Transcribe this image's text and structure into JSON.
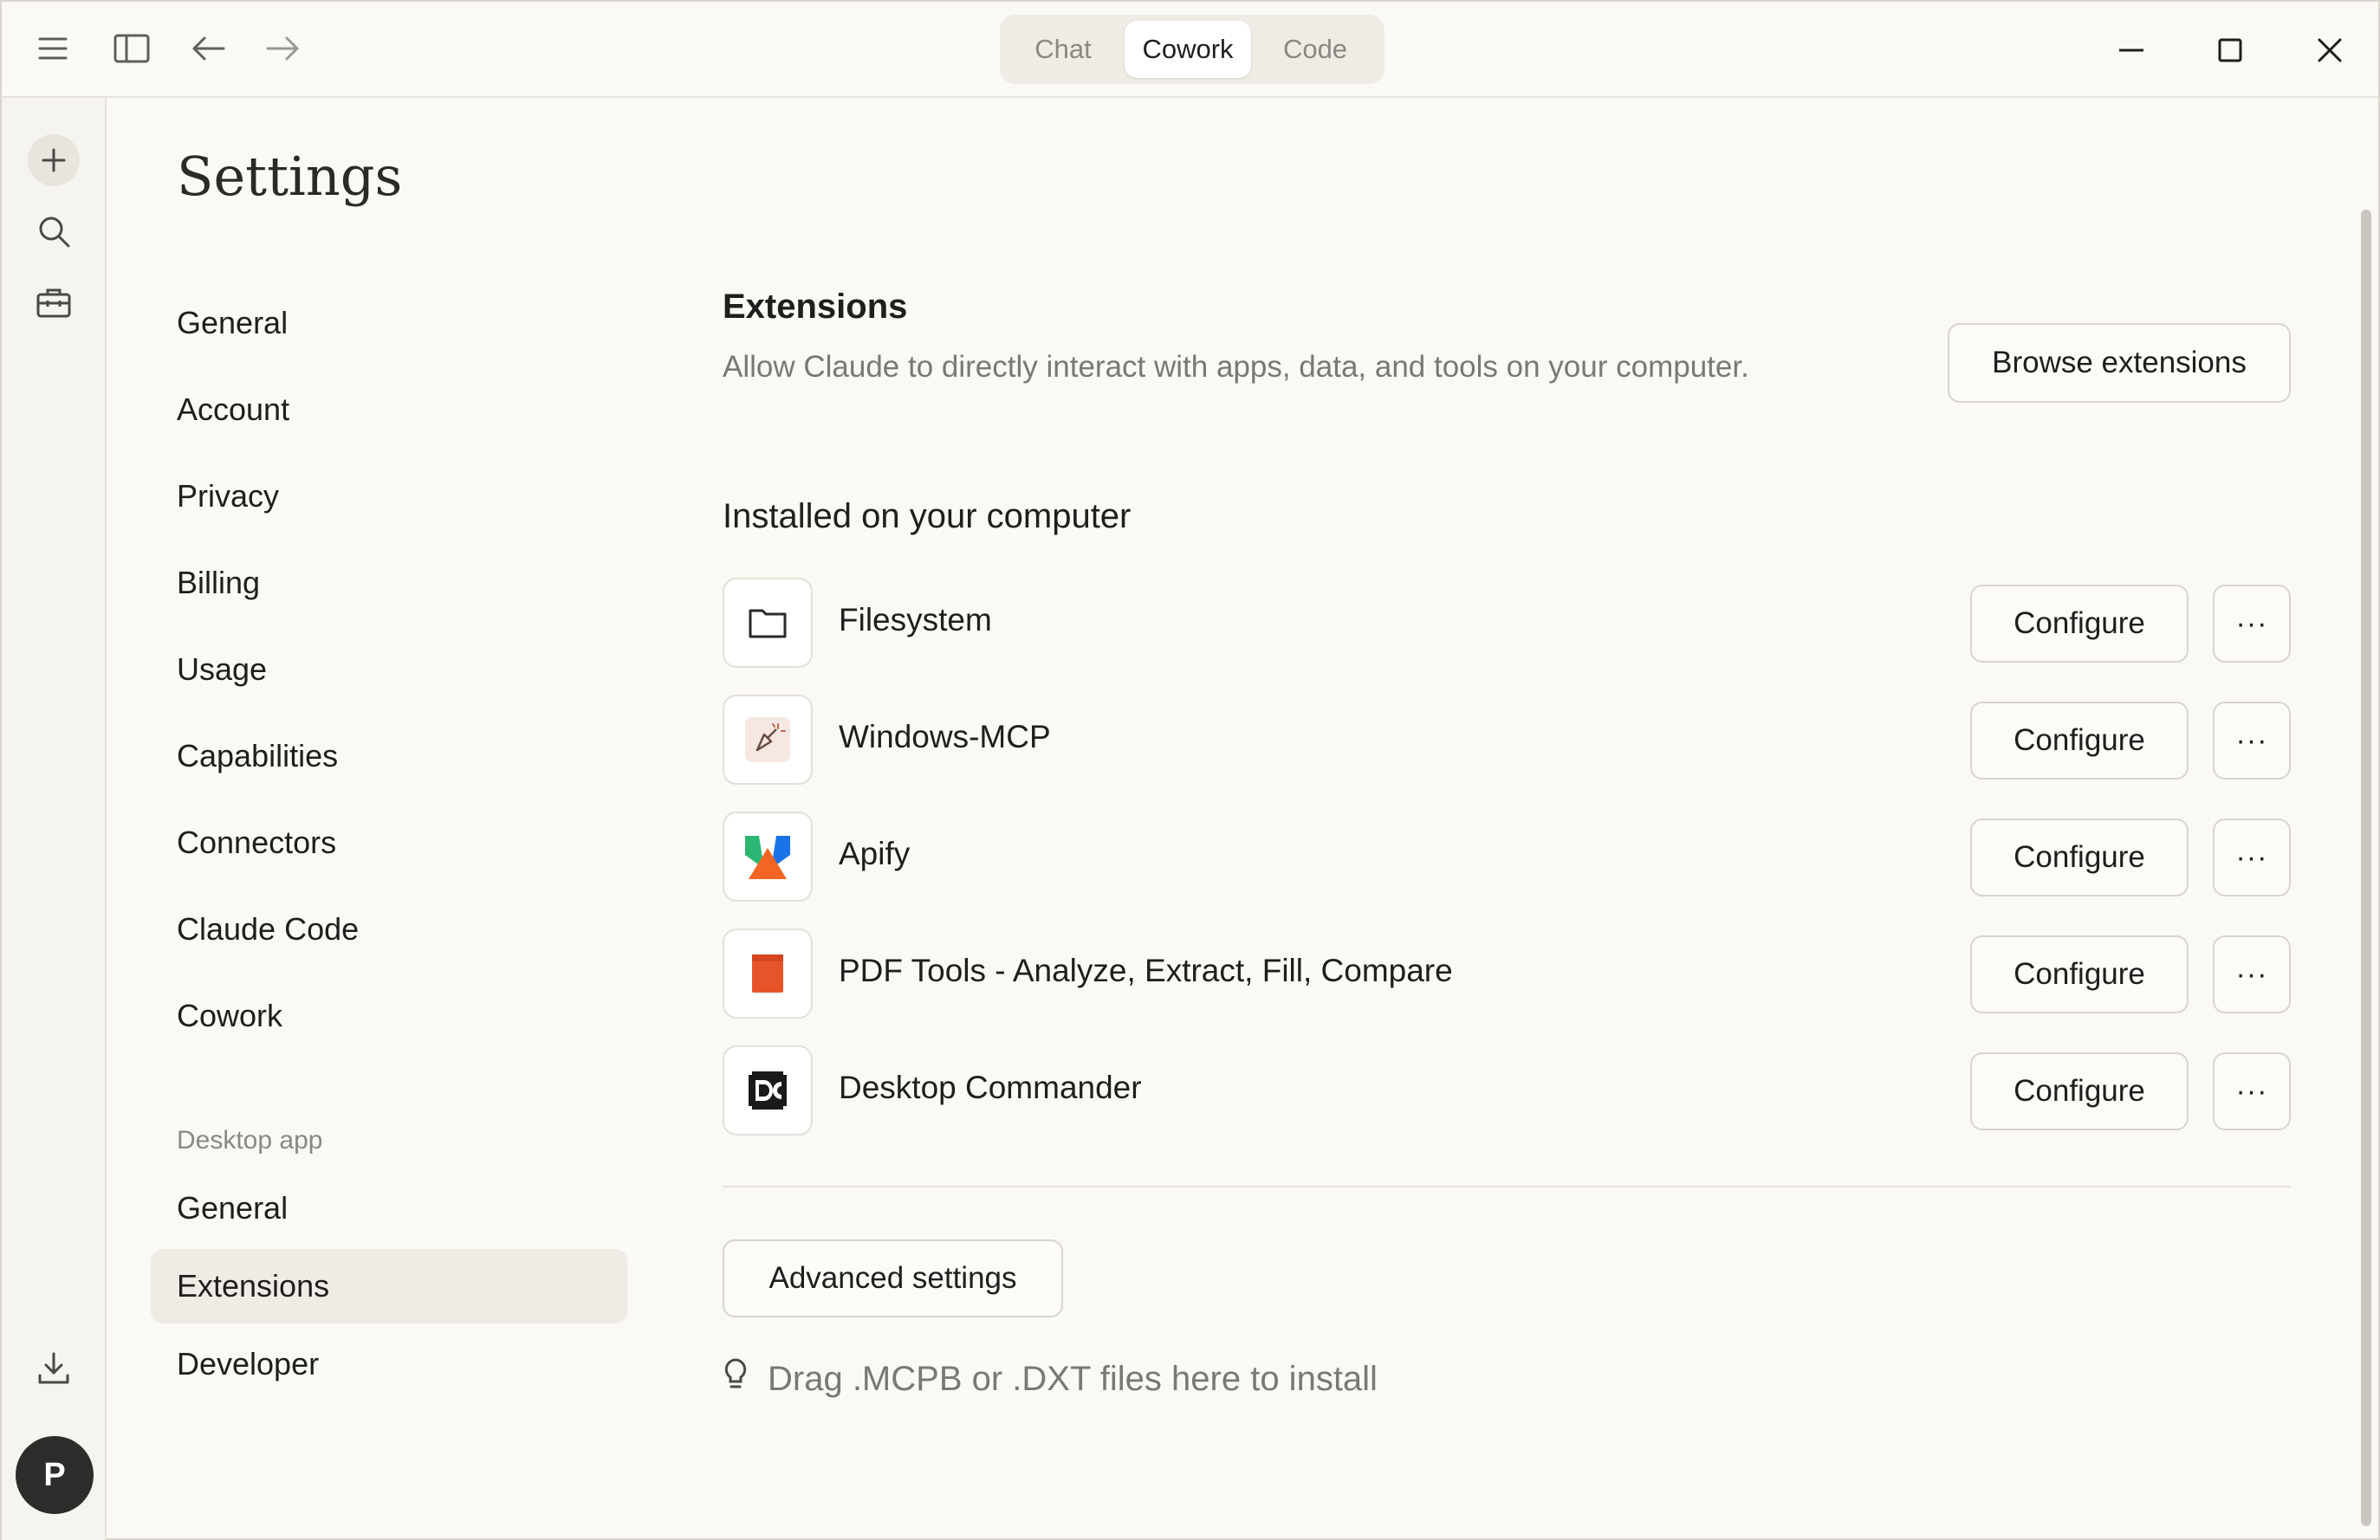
{
  "titlebar": {
    "modes": [
      "Chat",
      "Cowork",
      "Code"
    ],
    "active_mode": "Cowork"
  },
  "rail": {
    "avatar_initial": "P"
  },
  "settings": {
    "title": "Settings",
    "nav": [
      "General",
      "Account",
      "Privacy",
      "Billing",
      "Usage",
      "Capabilities",
      "Connectors",
      "Claude Code",
      "Cowork"
    ],
    "desktop_section_label": "Desktop app",
    "desktop_nav": [
      "General",
      "Extensions",
      "Developer"
    ],
    "active_desktop_item": "Extensions"
  },
  "extensions": {
    "title": "Extensions",
    "description": "Allow Claude to directly interact with apps, data, and tools on your computer.",
    "browse_label": "Browse extensions",
    "installed_title": "Installed on your computer",
    "items": [
      {
        "name": "Filesystem",
        "icon": "folder-icon"
      },
      {
        "name": "Windows-MCP",
        "icon": "cursor-sparkle-icon"
      },
      {
        "name": "Apify",
        "icon": "apify-logo-icon"
      },
      {
        "name": "PDF Tools - Analyze, Extract, Fill, Compare",
        "icon": "pdf-document-icon"
      },
      {
        "name": "Desktop Commander",
        "icon": "desktop-commander-logo-icon"
      }
    ],
    "configure_label": "Configure",
    "more_label": "···",
    "advanced_label": "Advanced settings",
    "drop_hint": "Drag .MCPB or .DXT files here to install"
  },
  "colors": {
    "background": "#faf9f5",
    "active_nav": "#efece5",
    "apify_green": "#2bb673",
    "apify_blue": "#1a73e8",
    "apify_orange": "#f26522",
    "pdf_orange": "#e8542a"
  }
}
